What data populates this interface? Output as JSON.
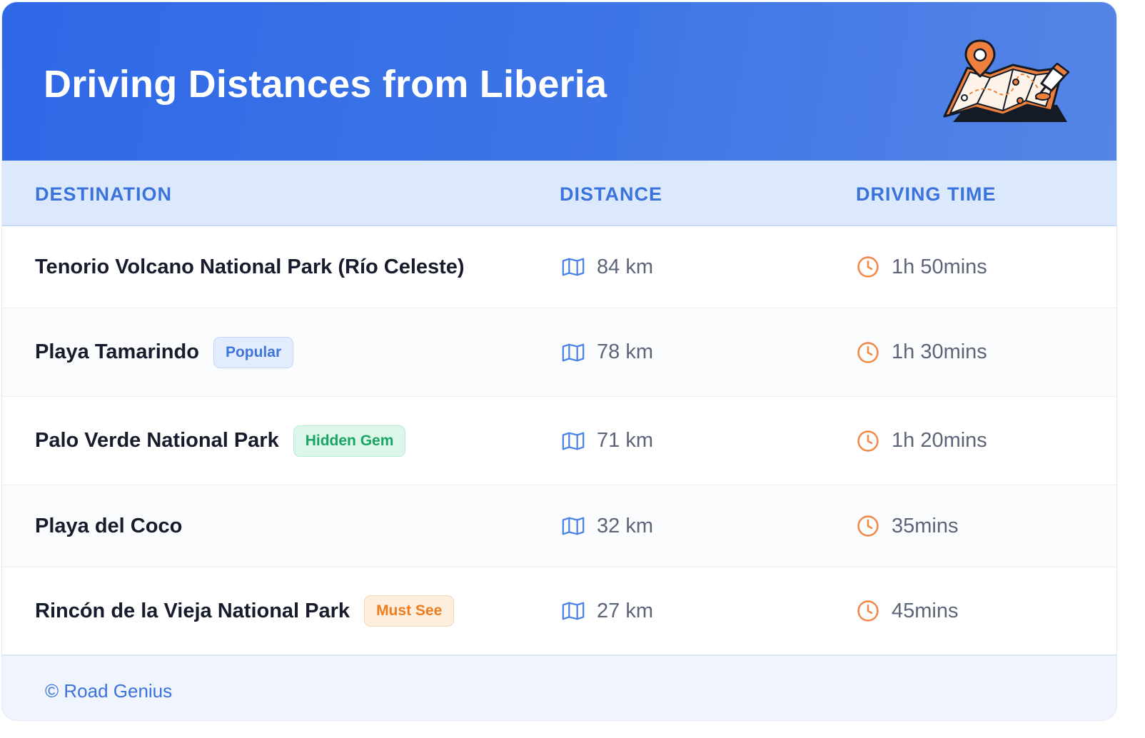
{
  "header": {
    "title": "Driving Distances from Liberia"
  },
  "table": {
    "columns": [
      "DESTINATION",
      "DISTANCE",
      "DRIVING TIME"
    ],
    "rows": [
      {
        "destination": "Tenorio Volcano National Park (Río Celeste)",
        "badge": "",
        "badge_color": "",
        "distance": "84 km",
        "time": "1h 50mins"
      },
      {
        "destination": "Playa Tamarindo",
        "badge": "Popular",
        "badge_color": "blue",
        "distance": "78 km",
        "time": "1h 30mins"
      },
      {
        "destination": "Palo Verde National Park",
        "badge": "Hidden Gem",
        "badge_color": "green",
        "distance": "71 km",
        "time": "1h 20mins"
      },
      {
        "destination": "Playa del Coco",
        "badge": "",
        "badge_color": "",
        "distance": "32 km",
        "time": "35mins"
      },
      {
        "destination": "Rincón de la Vieja National Park",
        "badge": "Must See",
        "badge_color": "orange",
        "distance": "27 km",
        "time": "45mins"
      }
    ]
  },
  "icons": {
    "header_illustration": "map-with-pins-icon",
    "distance": "map-icon",
    "time": "clock-icon"
  },
  "colors": {
    "header_gradient_start": "#2f68e7",
    "header_gradient_end": "#5585e6",
    "column_header_text": "#3b73dc",
    "icon_blue": "#4c82e4",
    "icon_orange": "#f2894a"
  },
  "footer": {
    "copyright": "© Road Genius"
  }
}
